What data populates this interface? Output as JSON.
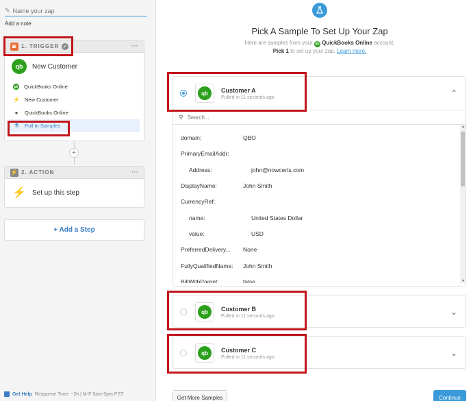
{
  "left": {
    "zap_name_placeholder": "Name your zap",
    "add_note": "Add a note",
    "trigger": {
      "header": "1. TRIGGER",
      "app_title": "New Customer",
      "steps": [
        {
          "icon": "quickbooks-icon",
          "label": "QuickBooks Online"
        },
        {
          "icon": "bolt-icon",
          "label": "New Customer"
        },
        {
          "icon": "user-icon",
          "label": "QuickBooks Online"
        },
        {
          "icon": "flask-icon",
          "label": "Pull In Samples"
        }
      ]
    },
    "action": {
      "header": "2. ACTION",
      "title": "Set up this step"
    },
    "add_step": "+ Add a Step",
    "footer": {
      "help": "Get Help",
      "response": "Response Time: ~2h | M-F 9am-5pm PST"
    }
  },
  "main": {
    "title": "Pick A Sample To Set Up Your Zap",
    "sub_prefix": "Here are samples from your",
    "sub_app": "QuickBooks Online",
    "sub_suffix": "account.",
    "pick_prefix": "Pick 1",
    "pick_suffix": "to set up your zap.",
    "learn_more": "Learn more.",
    "search_placeholder": "Search...",
    "samples": [
      {
        "name": "Customer A",
        "time": "Pulled in 11 seconds ago",
        "selected": true
      },
      {
        "name": "Customer B",
        "time": "Pulled in 11 seconds ago",
        "selected": false
      },
      {
        "name": "Customer C",
        "time": "Pulled in 11 seconds ago",
        "selected": false
      }
    ],
    "fields": [
      {
        "key": "domain:",
        "value": "QBO"
      },
      {
        "key": "PrimaryEmailAddr:",
        "value": ""
      },
      {
        "key": "Address:",
        "value": "john@nowcerts.com"
      },
      {
        "key": "DisplayName:",
        "value": "John Smith"
      },
      {
        "key": "CurrencyRef:",
        "value": ""
      },
      {
        "key": "name:",
        "value": "United States Dollar"
      },
      {
        "key": "value:",
        "value": "USD"
      },
      {
        "key": "PreferredDelivery...",
        "value": "None"
      },
      {
        "key": "FullyQualifiedName:",
        "value": "John Smith"
      },
      {
        "key": "BillWithParent:",
        "value": "false"
      }
    ],
    "get_more": "Get More Samples",
    "continue": "Continue"
  },
  "colors": {
    "accent": "#3b9ad9",
    "quickbooks": "#2ca01c",
    "highlight": "#c1151c"
  }
}
